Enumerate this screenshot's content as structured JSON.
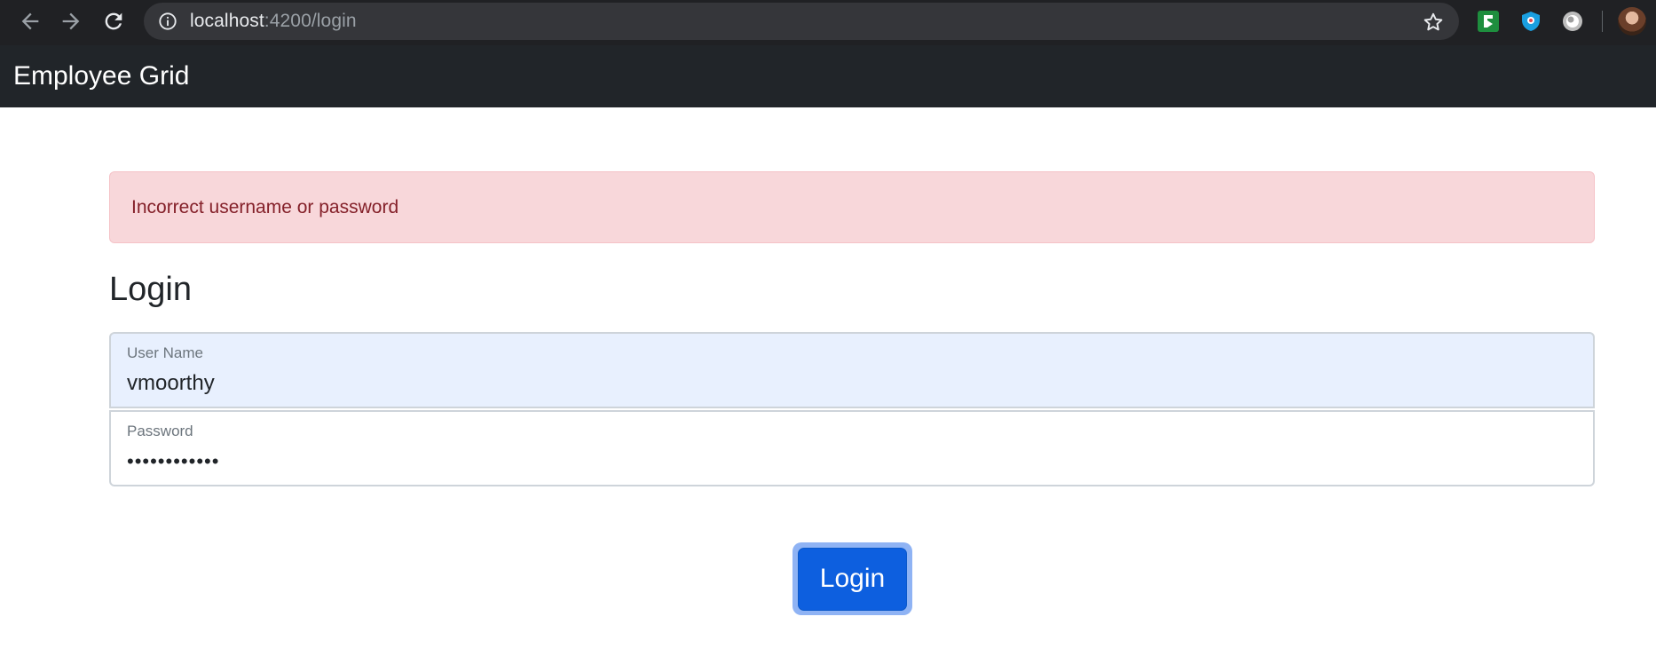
{
  "browser": {
    "url_host": "localhost",
    "url_path": ":4200/login"
  },
  "navbar": {
    "brand": "Employee Grid"
  },
  "alert": {
    "message": "Incorrect username or password",
    "color": "#842029",
    "background": "#f8d7da"
  },
  "form": {
    "title": "Login",
    "username_label": "User Name",
    "username_value": "vmoorthy",
    "password_label": "Password",
    "password_value": "vmoorthy1234",
    "submit_label": "Login"
  },
  "icons": {
    "back": "arrow-left-icon",
    "forward": "arrow-right-icon",
    "reload": "reload-icon",
    "info": "info-icon",
    "bookmark": "star-icon"
  },
  "colors": {
    "navbar": "#212529",
    "primary": "#0d5fdf"
  }
}
